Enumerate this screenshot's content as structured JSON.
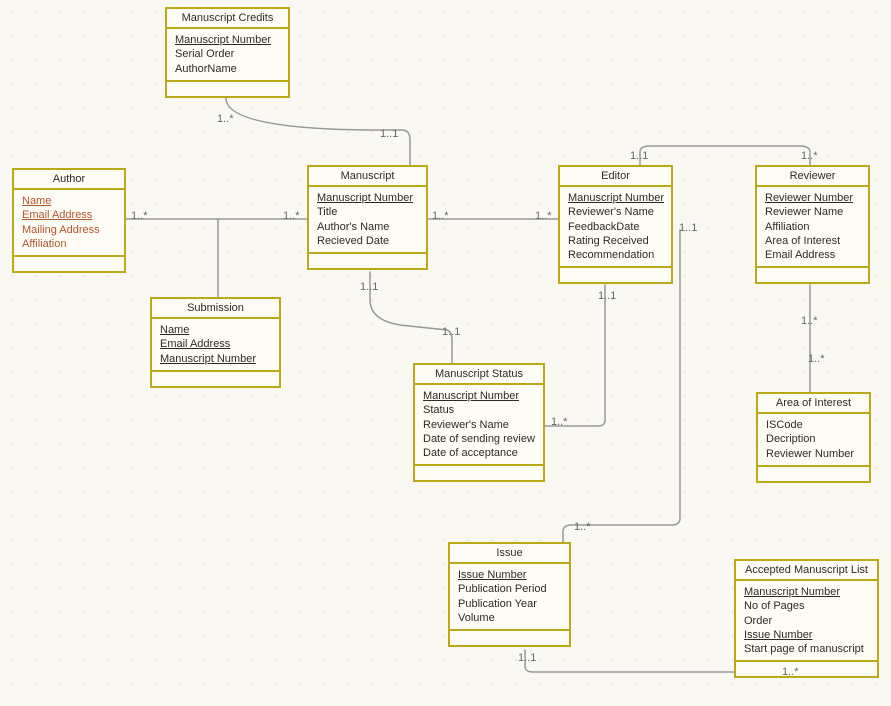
{
  "colors": {
    "border": "#bba919",
    "link": "#b1552b",
    "line": "#888"
  },
  "entities": {
    "manuscriptCredits": {
      "title": "Manuscript Credits",
      "attrs": [
        {
          "label": "Manuscript Number",
          "key": true
        },
        {
          "label": "Serial Order"
        },
        {
          "label": "AuthorName"
        }
      ]
    },
    "author": {
      "title": "Author",
      "attrs": [
        {
          "label": "Name",
          "key": true,
          "link": true
        },
        {
          "label": "Email Address",
          "key": true,
          "link": true
        },
        {
          "label": "Mailing Address",
          "link": true
        },
        {
          "label": "Affiliation",
          "link": true
        }
      ]
    },
    "manuscript": {
      "title": "Manuscript",
      "attrs": [
        {
          "label": "Manuscript Number",
          "key": true
        },
        {
          "label": "Title"
        },
        {
          "label": "Author's Name"
        },
        {
          "label": "Recieved Date"
        }
      ]
    },
    "editor": {
      "title": "Editor",
      "attrs": [
        {
          "label": "Manuscript Number",
          "key": true
        },
        {
          "label": "Reviewer's Name"
        },
        {
          "label": "FeedbackDate"
        },
        {
          "label": "Rating Received"
        },
        {
          "label": "Recommendation"
        }
      ]
    },
    "reviewer": {
      "title": "Reviewer",
      "attrs": [
        {
          "label": "Reviewer Number",
          "key": true
        },
        {
          "label": "Reviewer Name"
        },
        {
          "label": "Affiliation"
        },
        {
          "label": "Area of Interest"
        },
        {
          "label": "Email Address"
        }
      ]
    },
    "submission": {
      "title": "Submission",
      "attrs": [
        {
          "label": "Name",
          "key": true
        },
        {
          "label": "Email Address",
          "key": true
        },
        {
          "label": "Manuscript Number",
          "key": true
        }
      ]
    },
    "manuscriptStatus": {
      "title": "Manuscript Status",
      "attrs": [
        {
          "label": "Manuscript Number",
          "key": true
        },
        {
          "label": "Status"
        },
        {
          "label": "Reviewer's Name"
        },
        {
          "label": "Date of sending review"
        },
        {
          "label": "Date of acceptance"
        }
      ]
    },
    "areaOfInterest": {
      "title": "Area of Interest",
      "attrs": [
        {
          "label": "ISCode"
        },
        {
          "label": "Decription"
        },
        {
          "label": "Reviewer Number"
        }
      ]
    },
    "issue": {
      "title": "Issue",
      "attrs": [
        {
          "label": "Issue Number",
          "key": true
        },
        {
          "label": "Publication Period"
        },
        {
          "label": "Publication Year"
        },
        {
          "label": "Volume"
        }
      ]
    },
    "acceptedManuscriptList": {
      "title": "Accepted Manuscript List",
      "attrs": [
        {
          "label": "Manuscript Number",
          "key": true
        },
        {
          "label": "No of Pages"
        },
        {
          "label": "Order"
        },
        {
          "label": "Issue Number",
          "key": true
        },
        {
          "label": "Start page of manuscript"
        }
      ]
    }
  },
  "multiplicities": {
    "m1star_a": "1..*",
    "m11": "1..1"
  },
  "connections": [
    {
      "from": "author",
      "to": "submission",
      "to2": "manuscript",
      "left": "1..*",
      "right": "1..*"
    },
    {
      "from": "manuscriptCredits",
      "to": "manuscript",
      "left": "1..*",
      "right": "1..1"
    },
    {
      "from": "manuscript",
      "to": "editor",
      "left": "1..*",
      "right": "1..*"
    },
    {
      "from": "manuscript",
      "to": "manuscriptStatus",
      "left": "1..1",
      "right": "1..1"
    },
    {
      "from": "editor",
      "to": "reviewer",
      "left": "1..1",
      "right": "1..*"
    },
    {
      "from": "editor",
      "to": "manuscriptStatus",
      "left": "1..1",
      "right": "1..*"
    },
    {
      "from": "editor",
      "to": "issue",
      "left": "1..1",
      "right": "1..*"
    },
    {
      "from": "reviewer",
      "to": "areaOfInterest",
      "left": "1..*",
      "right": "1..*"
    },
    {
      "from": "issue",
      "to": "acceptedManuscriptList",
      "left": "1..1",
      "right": "1..*"
    }
  ]
}
